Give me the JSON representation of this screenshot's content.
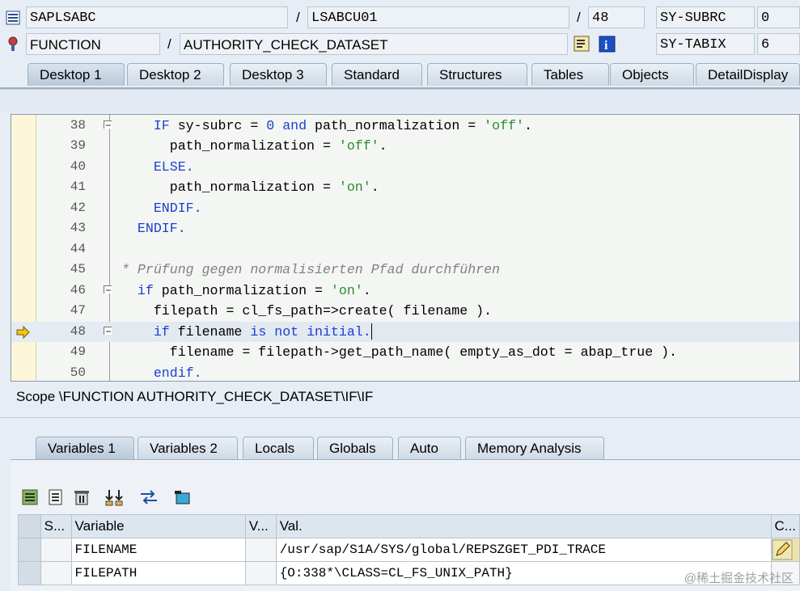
{
  "header": {
    "program": "SAPLSABC",
    "include": "LSABCU01",
    "line": "48",
    "subrc_label": "SY-SUBRC",
    "subrc_value": "0",
    "event_type": "FUNCTION",
    "event_name": "AUTHORITY_CHECK_DATASET",
    "tabix_label": "SY-TABIX",
    "tabix_value": "6",
    "slash": "/"
  },
  "desktop_tabs": [
    "Desktop 1",
    "Desktop 2",
    "Desktop 3",
    "Standard",
    "Structures",
    "Tables",
    "Objects",
    "DetailDisplay"
  ],
  "code_lines": [
    {
      "n": "38",
      "parts": [
        [
          "    ",
          ""
        ],
        [
          "IF",
          "kw"
        ],
        [
          " sy-subrc = ",
          ""
        ],
        [
          "0",
          "num"
        ],
        [
          " ",
          ""
        ],
        [
          "and",
          "kw"
        ],
        [
          " path_normalization = ",
          ""
        ],
        [
          "'off'",
          "str"
        ],
        [
          ".",
          ""
        ]
      ]
    },
    {
      "n": "39",
      "parts": [
        [
          "      path_normalization = ",
          ""
        ],
        [
          "'off'",
          "str"
        ],
        [
          ".",
          ""
        ]
      ]
    },
    {
      "n": "40",
      "parts": [
        [
          "    ",
          ""
        ],
        [
          "ELSE.",
          "kw"
        ]
      ]
    },
    {
      "n": "41",
      "parts": [
        [
          "      path_normalization = ",
          ""
        ],
        [
          "'on'",
          "str"
        ],
        [
          ".",
          ""
        ]
      ]
    },
    {
      "n": "42",
      "parts": [
        [
          "    ",
          ""
        ],
        [
          "ENDIF.",
          "kw"
        ]
      ]
    },
    {
      "n": "43",
      "parts": [
        [
          "  ",
          ""
        ],
        [
          "ENDIF.",
          "kw"
        ]
      ]
    },
    {
      "n": "44",
      "parts": []
    },
    {
      "n": "45",
      "parts": [
        [
          "* Prüfung gegen normalisierten Pfad durchführen",
          "cmt"
        ]
      ]
    },
    {
      "n": "46",
      "parts": [
        [
          "  ",
          ""
        ],
        [
          "if",
          "kw"
        ],
        [
          " path_normalization = ",
          ""
        ],
        [
          "'on'",
          "str"
        ],
        [
          ".",
          ""
        ]
      ]
    },
    {
      "n": "47",
      "parts": [
        [
          "    filepath = cl_fs_path=>create( filename ).",
          ""
        ]
      ]
    },
    {
      "n": "48",
      "parts": [
        [
          "    ",
          ""
        ],
        [
          "if",
          "kw"
        ],
        [
          " filename ",
          ""
        ],
        [
          "is not initial.",
          "kw"
        ]
      ]
    },
    {
      "n": "49",
      "parts": [
        [
          "      filename = filepath->get_path_name( empty_as_dot = abap_true ).",
          ""
        ]
      ]
    },
    {
      "n": "50",
      "parts": [
        [
          "    ",
          ""
        ],
        [
          "endif.",
          "kw"
        ]
      ]
    }
  ],
  "scope_text": "Scope \\FUNCTION AUTHORITY_CHECK_DATASET\\IF\\IF",
  "variable_tabs": [
    "Variables 1",
    "Variables 2",
    "Locals",
    "Globals",
    "Auto",
    "Memory Analysis"
  ],
  "table": {
    "headers": {
      "s": "S...",
      "variable": "Variable",
      "v": "V...",
      "value": "Val.",
      "c": "C..."
    },
    "rows": [
      {
        "variable": "FILENAME",
        "value": "/usr/sap/S1A/SYS/global/REPSZGET_PDI_TRACE"
      },
      {
        "variable": "FILEPATH",
        "value": "{O:338*\\CLASS=CL_FS_UNIX_PATH}"
      }
    ]
  },
  "watermark": "@稀土掘金技术社区",
  "icons": [
    "program-icon",
    "event-icon",
    "display-source-icon",
    "info-icon",
    "current-line-arrow-icon",
    "toolbar-icons"
  ],
  "colors": {
    "keyword": "#1a3fd0",
    "string": "#2f8b2f",
    "comment": "#808080",
    "gutter": "#fbf6d9"
  }
}
